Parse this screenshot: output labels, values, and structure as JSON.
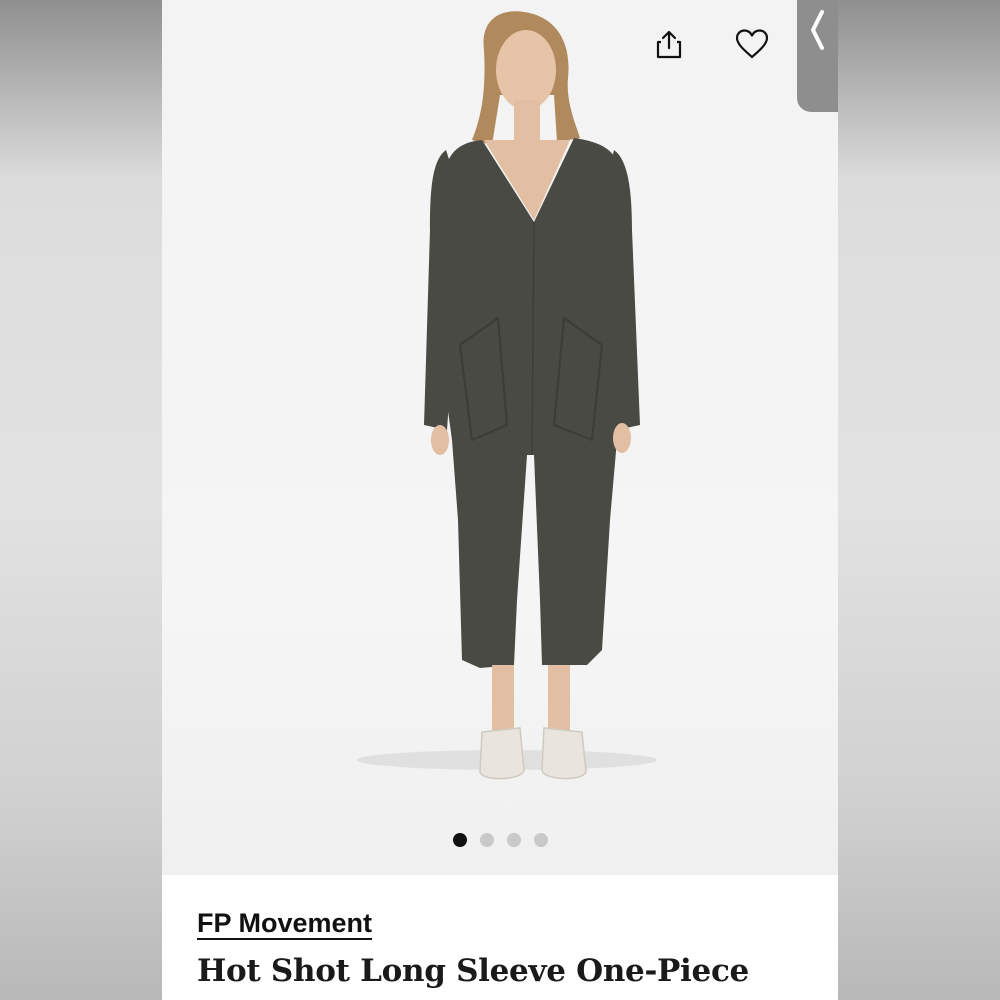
{
  "header": {
    "share_icon": "share-icon",
    "favorite_icon": "heart-icon",
    "back_icon": "chevron-left-icon"
  },
  "gallery": {
    "image_count": 4,
    "active_index": 0
  },
  "product": {
    "brand": "FP Movement",
    "title": "Hot Shot Long Sleeve One-Piece"
  },
  "colors": {
    "accent": "#111111",
    "dot_inactive": "#c9c9c9",
    "garment": "#4a4a44"
  }
}
